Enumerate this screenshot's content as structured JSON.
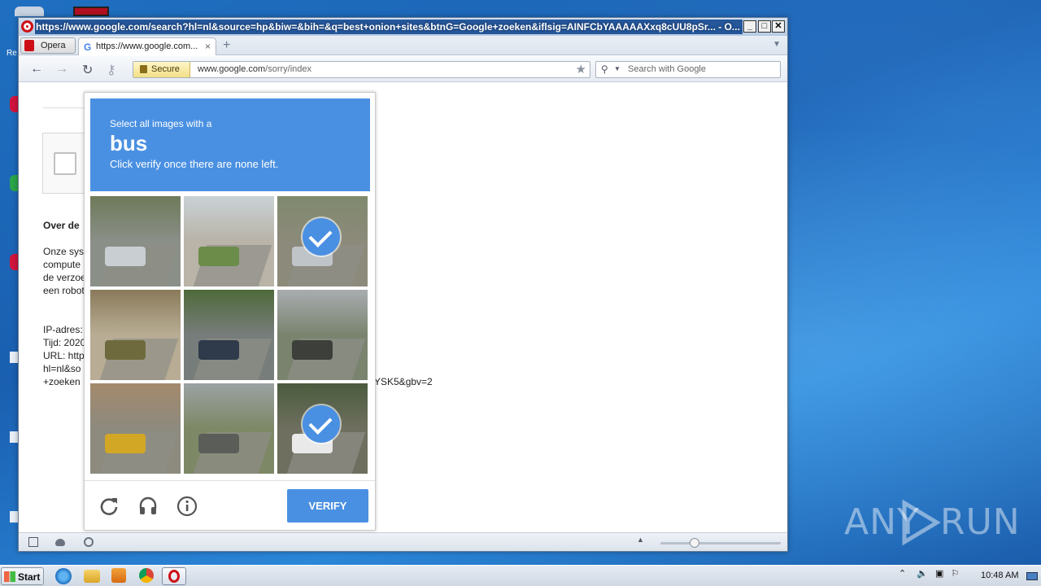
{
  "window": {
    "title": "https://www.google.com/search?hl=nl&source=hp&biw=&bih=&q=best+onion+sites&btnG=Google+zoeken&iflsig=AINFCbYAAAAAXxq8cUU8pSr... - O...",
    "minimize": "_",
    "maximize": "□",
    "close": "✕"
  },
  "tabs": {
    "opera_menu": "Opera",
    "active_tab": "https://www.google.com...",
    "close_glyph": "×",
    "new_tab_glyph": "+"
  },
  "toolbar": {
    "secure_label": "Secure",
    "url_domain": "www.google.com",
    "url_path": "/sorry/index",
    "search_placeholder": "Search with Google"
  },
  "page": {
    "heading": "Over de",
    "para_lines": [
      "Onze sys",
      "compute",
      "de verzoe",
      "een robot"
    ],
    "info_lines": [
      "IP-adres:",
      "Tijd: 2020",
      "URL: http",
      "hl=nl&so",
      "+zoeken"
    ],
    "url_tail": "YSK5&gbv=2"
  },
  "captcha": {
    "line1": "Select all images with a",
    "keyword": "bus",
    "line3": "Click verify once there are none left.",
    "verify_label": "VERIFY",
    "tiles": [
      {
        "scene": "suv-street",
        "checked": false
      },
      {
        "scene": "bridge-road",
        "checked": false
      },
      {
        "scene": "bus-trees",
        "checked": true
      },
      {
        "scene": "sidewalk-trees",
        "checked": false
      },
      {
        "scene": "highway-car",
        "checked": false
      },
      {
        "scene": "palm-tree",
        "checked": false
      },
      {
        "scene": "school-bus-road",
        "checked": false
      },
      {
        "scene": "rural-road",
        "checked": false
      },
      {
        "scene": "shuttle-bus",
        "checked": true
      }
    ]
  },
  "taskbar": {
    "start_label": "Start",
    "clock": "10:48 AM"
  },
  "watermark": {
    "left": "ANY",
    "right": "RUN"
  },
  "colors": {
    "captcha_blue": "#4a90e2",
    "opera_red": "#cc0f16"
  }
}
